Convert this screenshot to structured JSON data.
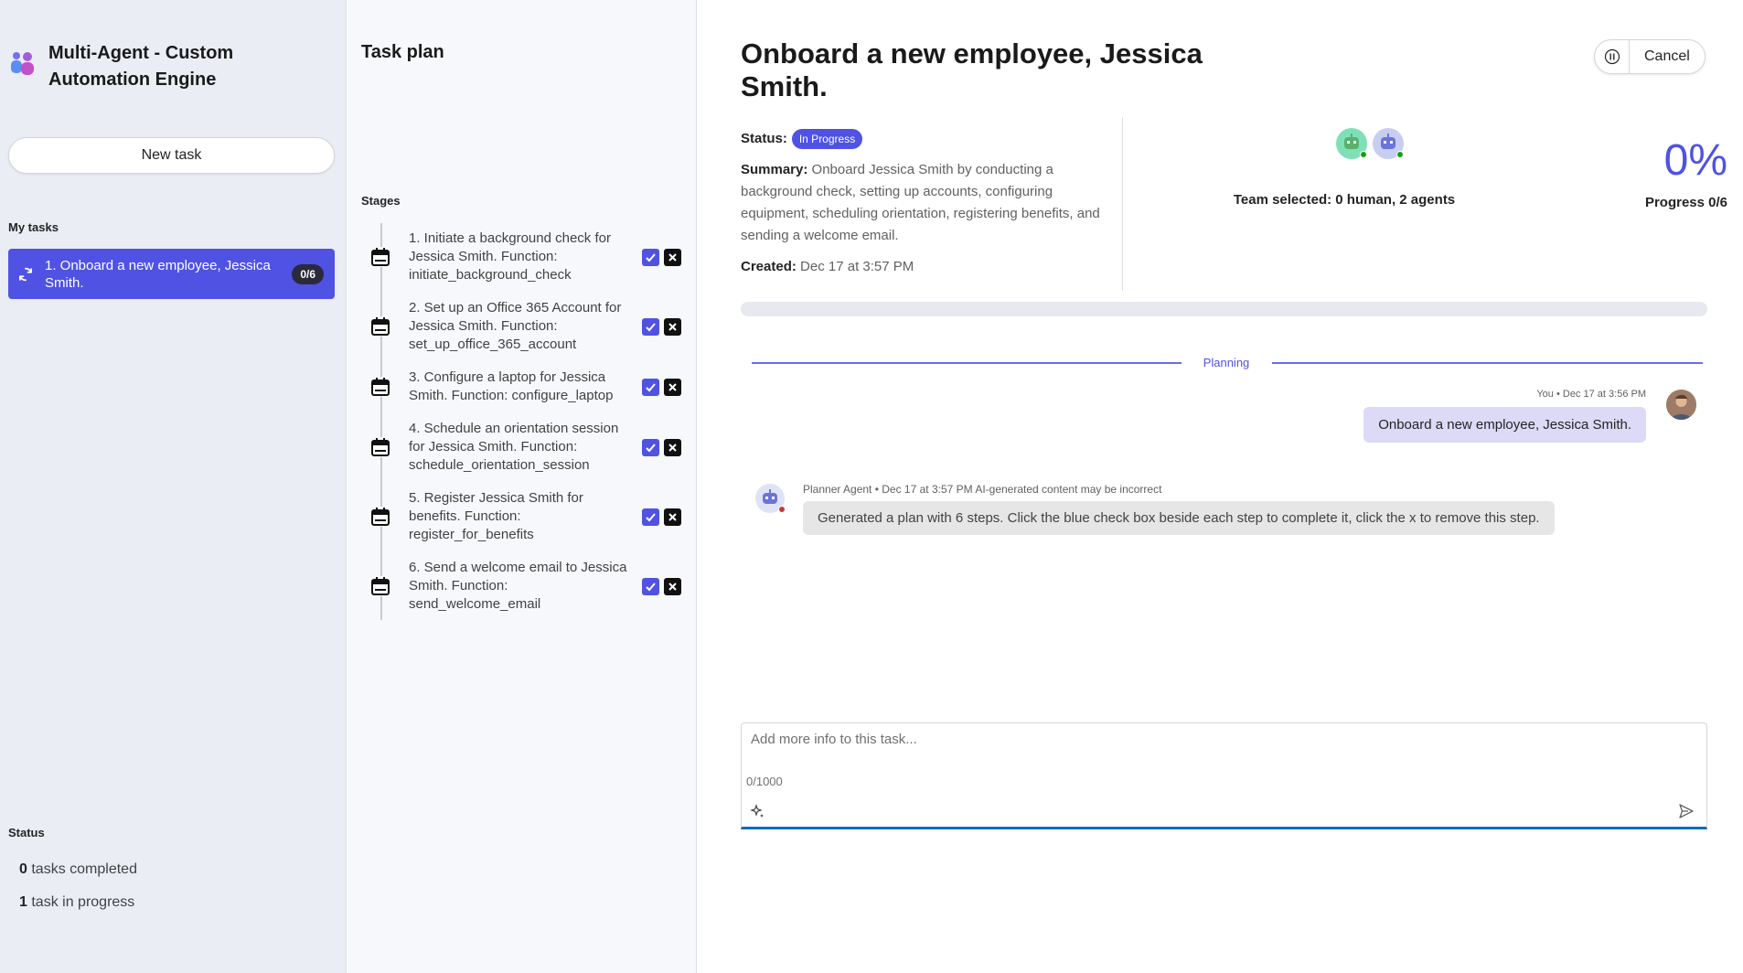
{
  "app": {
    "title": "Multi-Agent - Custom Automation Engine",
    "new_task_label": "New task",
    "my_tasks_label": "My tasks",
    "tasks": [
      {
        "label": "1. Onboard a new employee, Jessica Smith.",
        "count": "0/6"
      }
    ],
    "status_label": "Status",
    "status_completed_count": "0",
    "status_completed_text": "tasks completed",
    "status_progress_count": "1",
    "status_progress_text": "task in progress"
  },
  "plan": {
    "title": "Task plan",
    "stages_label": "Stages",
    "steps": [
      {
        "text": "1. Initiate a background check for Jessica Smith. Function: initiate_background_check"
      },
      {
        "text": "2. Set up an Office 365 Account for Jessica Smith. Function: set_up_office_365_account"
      },
      {
        "text": "3. Configure a laptop for Jessica Smith. Function: configure_laptop"
      },
      {
        "text": "4. Schedule an orientation session for Jessica Smith. Function: schedule_orientation_session"
      },
      {
        "text": "5. Register Jessica Smith for benefits. Function: register_for_benefits"
      },
      {
        "text": "6. Send a welcome email to Jessica Smith. Function: send_welcome_email"
      }
    ]
  },
  "main": {
    "title": "Onboard a new employee, Jessica Smith.",
    "cancel_label": "Cancel",
    "status_label": "Status:",
    "status_value": "In Progress",
    "summary_label": "Summary:",
    "summary_text": "Onboard Jessica Smith by conducting a background check, setting up accounts, configuring equipment, scheduling orientation, registering benefits, and sending a welcome email.",
    "created_label": "Created:",
    "created_value": "Dec 17 at 3:57 PM",
    "team_label": "Team selected: 0 human, 2 agents",
    "progress_percent": "0%",
    "progress_label": "Progress 0/6",
    "progress_fraction": 0
  },
  "chat": {
    "divider_label": "Planning",
    "user_meta": "You • Dec 17 at 3:56 PM",
    "user_message": "Onboard a new employee, Jessica Smith.",
    "agent_meta": "Planner Agent • Dec 17 at 3:57 PM AI-generated content may be incorrect",
    "agent_message": "Generated a plan with 6 steps. Click the blue check box beside each step to complete it, click the x to remove this step."
  },
  "composer": {
    "placeholder": "Add more info to this task...",
    "char_count": "0/1000"
  },
  "colors": {
    "accent": "#4f52e3",
    "sidebar_bg": "#ebedf5",
    "user_bubble": "#dcdaf7",
    "focus_underline": "#0f6cbd"
  }
}
